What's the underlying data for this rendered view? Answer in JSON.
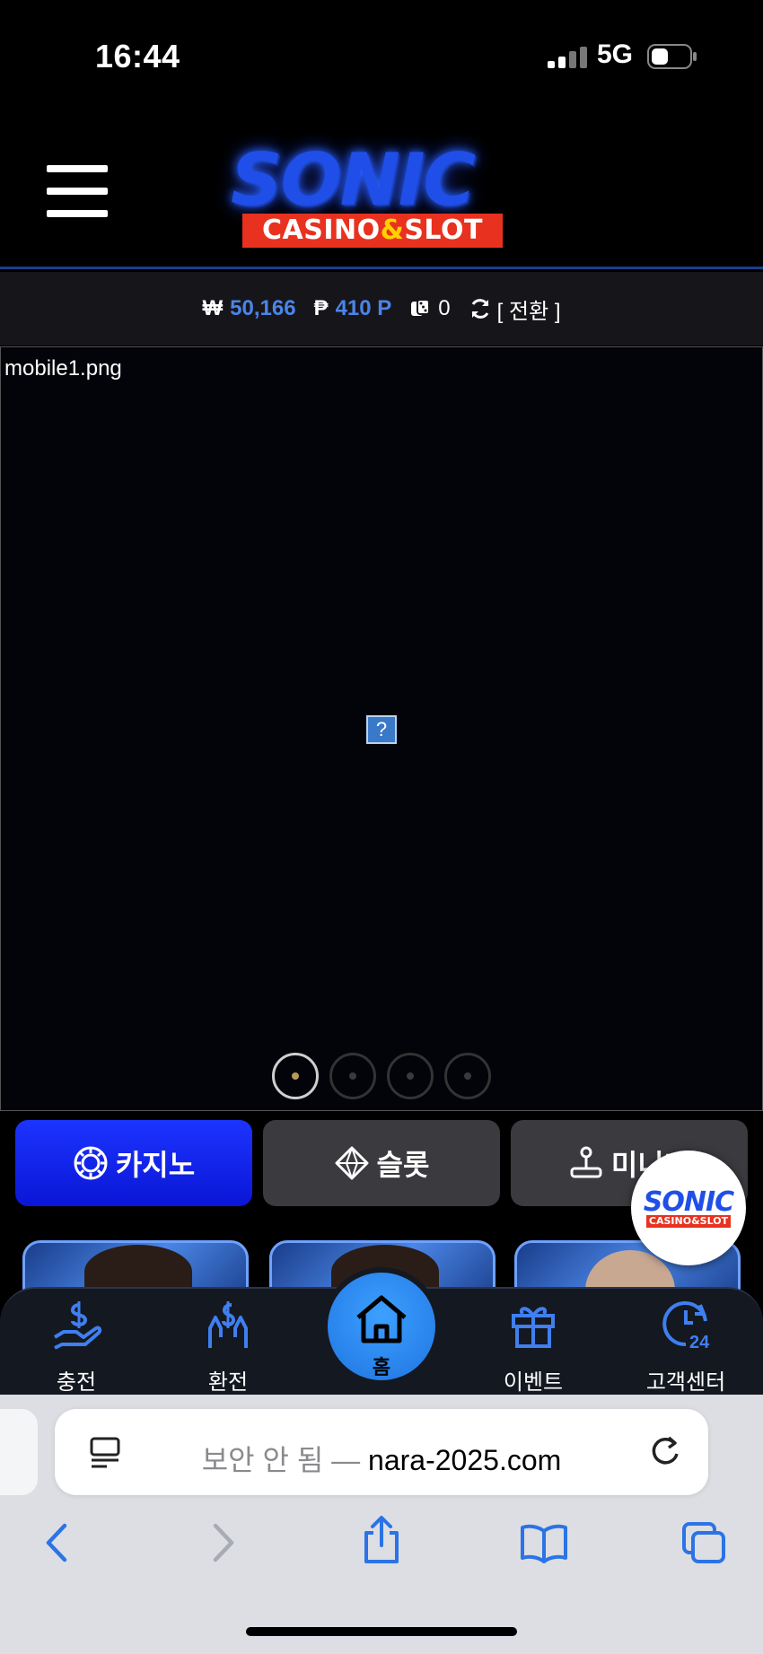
{
  "status_bar": {
    "time": "16:44",
    "network": "5G"
  },
  "header": {
    "logo_title": "SONIC",
    "logo_sub_1": "CASINO",
    "logo_sub_amp": "&",
    "logo_sub_2": "SLOT"
  },
  "balance": {
    "won_symbol": "₩",
    "won_value": "50,166",
    "point_symbol": "₱",
    "point_value": "410 P",
    "chip_value": "0",
    "toggle_label": "[ 전환 ]"
  },
  "banner": {
    "alt_text": "mobile1.png",
    "broken_glyph": "?",
    "slide_count": 4,
    "active_slide": 1
  },
  "categories": [
    {
      "label": "카지노",
      "icon": "chip-icon"
    },
    {
      "label": "슬롯",
      "icon": "diamond-icon"
    },
    {
      "label": "미니게",
      "icon": "joystick-icon"
    }
  ],
  "float_logo": {
    "title": "SONIC",
    "sub": "CASINO&SLOT"
  },
  "bottom_nav": [
    {
      "label": "충전",
      "icon": "deposit-icon"
    },
    {
      "label": "환전",
      "icon": "withdraw-icon"
    },
    {
      "label": "홈",
      "icon": "home-icon"
    },
    {
      "label": "이벤트",
      "icon": "gift-icon"
    },
    {
      "label": "고객센터",
      "icon": "support-24-icon"
    }
  ],
  "browser": {
    "security_label": "보안 안 됨 —",
    "domain": "nara-2025.com"
  },
  "colors": {
    "accent_blue": "#4b84ea",
    "casino_tab": "#1c34ff",
    "nav_home": "#2a8cf0",
    "logo_red": "#e8321f"
  }
}
